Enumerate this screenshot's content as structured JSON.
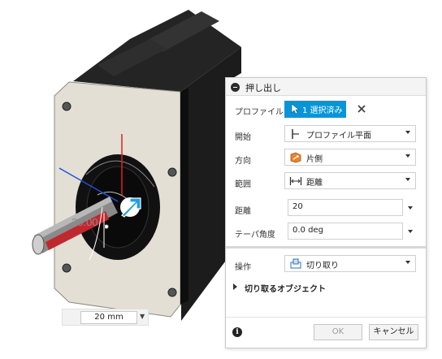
{
  "viewport": {
    "dimension_input": {
      "value": "20 mm"
    },
    "dimension_label": "20.00",
    "colors": {
      "body_dark": "#1d1d1d",
      "plate": "#e3dfd5",
      "shaft": "#8a8a8a",
      "shaft_highlight": "#c0282f",
      "arrow": "#1e9fe6"
    }
  },
  "panel": {
    "title": "押し出し",
    "profile": {
      "label": "プロファイル",
      "button_text": "1 選択済み"
    },
    "start": {
      "label": "開始",
      "value": "プロファイル平面"
    },
    "direction": {
      "label": "方向",
      "value": "片側"
    },
    "extent": {
      "label": "範囲",
      "value": "距離"
    },
    "distance": {
      "label": "距離",
      "value": "20"
    },
    "taper": {
      "label": "テーパ角度",
      "value": "0.0 deg"
    },
    "operation": {
      "label": "操作",
      "value": "切り取り"
    },
    "objects_section": {
      "label": "切り取るオブジェクト"
    },
    "ok_label": "OK",
    "cancel_label": "キャンセル",
    "accent": "#0696d7"
  }
}
